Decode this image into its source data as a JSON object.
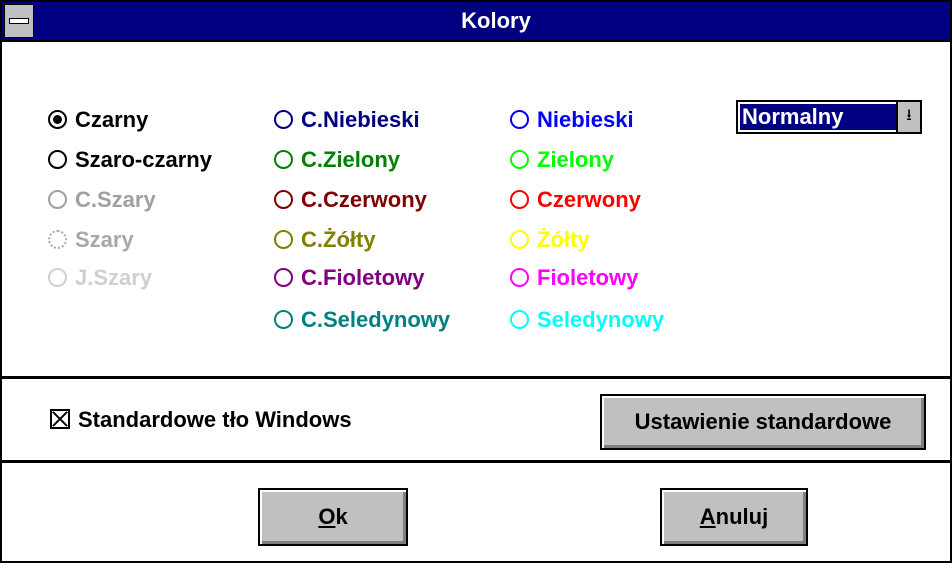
{
  "window": {
    "title": "Kolory"
  },
  "grays": [
    {
      "label": "Czarny",
      "color": "#000000",
      "selected": true
    },
    {
      "label": "Szaro-czarny",
      "color": "#000000",
      "selected": false
    },
    {
      "label": "C.Szary",
      "color": "#a0a0a0",
      "selected": false
    },
    {
      "label": "Szary",
      "color": "#c0c0c0",
      "selected": false
    },
    {
      "label": "J.Szary",
      "color": "#d0d0d0",
      "selected": false
    }
  ],
  "dark_colors": [
    {
      "label": "C.Niebieski",
      "color": "#000080",
      "selected": false
    },
    {
      "label": "C.Zielony",
      "color": "#008000",
      "selected": false
    },
    {
      "label": "C.Czerwony",
      "color": "#800000",
      "selected": false
    },
    {
      "label": "C.Żółty",
      "color": "#808000",
      "selected": false
    },
    {
      "label": "C.Fioletowy",
      "color": "#800080",
      "selected": false
    },
    {
      "label": "C.Seledynowy",
      "color": "#008080",
      "selected": false
    }
  ],
  "bright_colors": [
    {
      "label": "Niebieski",
      "color": "#0000ff",
      "selected": false
    },
    {
      "label": "Zielony",
      "color": "#00ff00",
      "selected": false
    },
    {
      "label": "Czerwony",
      "color": "#ff0000",
      "selected": false
    },
    {
      "label": "Żółty",
      "color": "#ffff00",
      "selected": false
    },
    {
      "label": "Fioletowy",
      "color": "#ff00ff",
      "selected": false
    },
    {
      "label": "Seledynowy",
      "color": "#00ffff",
      "selected": false
    }
  ],
  "mode_select": {
    "value": "Normalny",
    "arrow_icon": "down-arrow-icon"
  },
  "standard_background": {
    "label": "Standardowe tło Windows",
    "checked": true
  },
  "buttons": {
    "defaults": "Ustawienie standardowe",
    "ok_mnemonic": "O",
    "ok_rest": "k",
    "cancel_mnemonic": "A",
    "cancel_rest": "nuluj"
  }
}
